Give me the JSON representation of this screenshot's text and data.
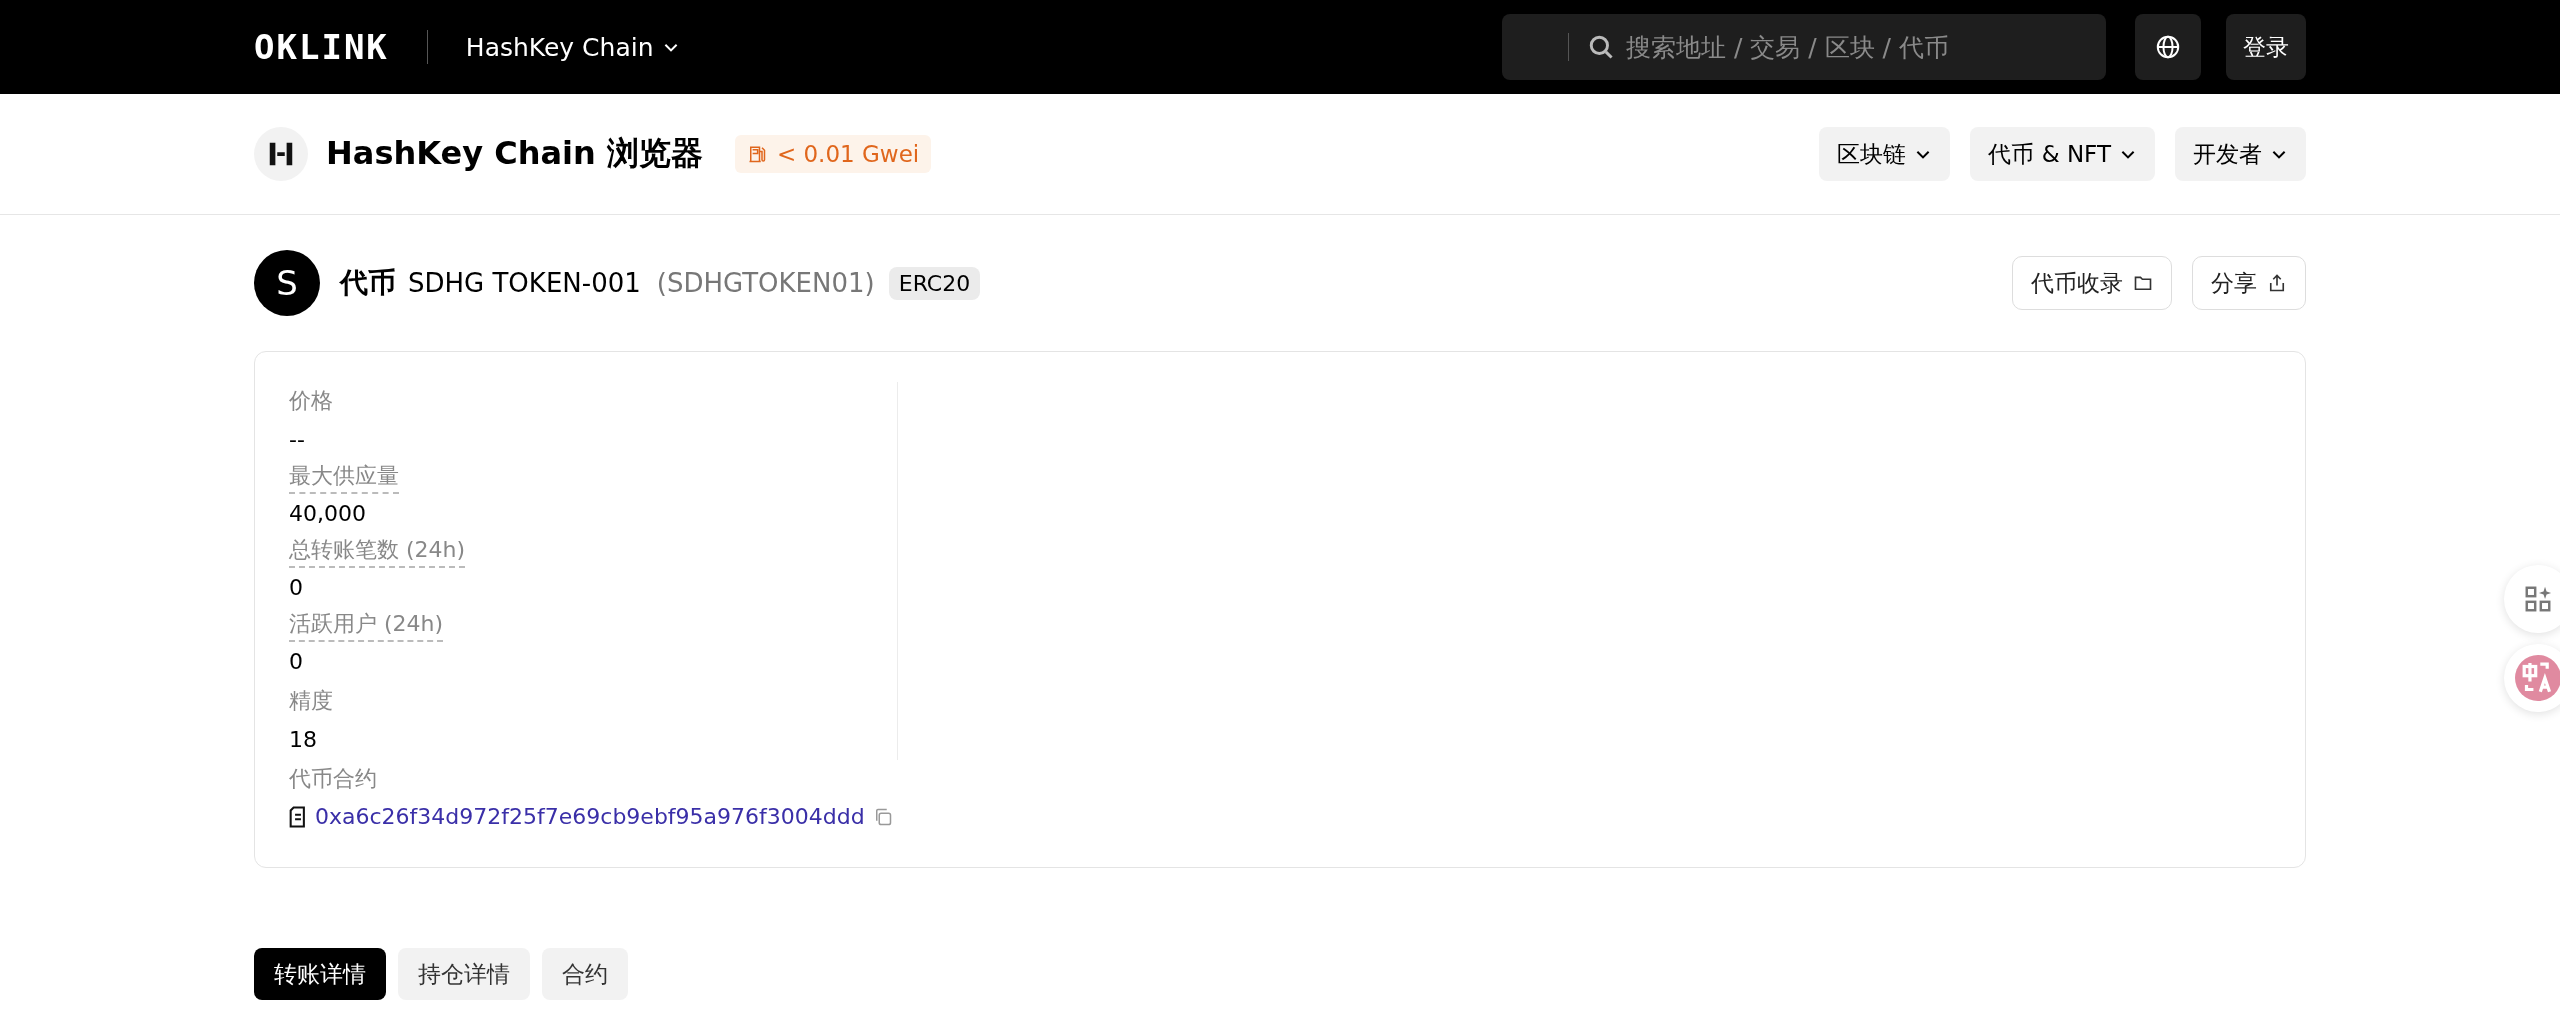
{
  "topbar": {
    "logo": "OKLINK",
    "chain": "HashKey Chain",
    "search": {
      "placeholder": "搜索地址 / 交易 / 区块 / 代币"
    },
    "login": "登录"
  },
  "header": {
    "title": "HashKey Chain 浏览器",
    "gas": "< 0.01 Gwei",
    "menus": [
      "区块链",
      "代币 & NFT",
      "开发者"
    ]
  },
  "token": {
    "avatar": "S",
    "type_label": "代币",
    "name": "SDHG TOKEN-001",
    "symbol": "(SDHGTOKEN01)",
    "standard": "ERC20",
    "actions": [
      {
        "label": "代币收录"
      },
      {
        "label": "分享"
      }
    ]
  },
  "stats": [
    {
      "label": "价格",
      "value": "--",
      "hint": false
    },
    {
      "label": "最大供应量",
      "value": "40,000",
      "hint": true
    },
    {
      "label": "总转账笔数 (24h)",
      "value": "0",
      "hint": true
    },
    {
      "label": "活跃用户 (24h)",
      "value": "0",
      "hint": true
    },
    {
      "label": "精度",
      "value": "18",
      "hint": false
    }
  ],
  "contract": {
    "label": "代币合约",
    "address": "0xa6c26f34d972f25f7e69cb9ebf95a976f3004ddd"
  },
  "tabs": [
    {
      "label": "转账详情",
      "selected": true
    },
    {
      "label": "持仓详情",
      "selected": false
    },
    {
      "label": "合约",
      "selected": false
    }
  ]
}
